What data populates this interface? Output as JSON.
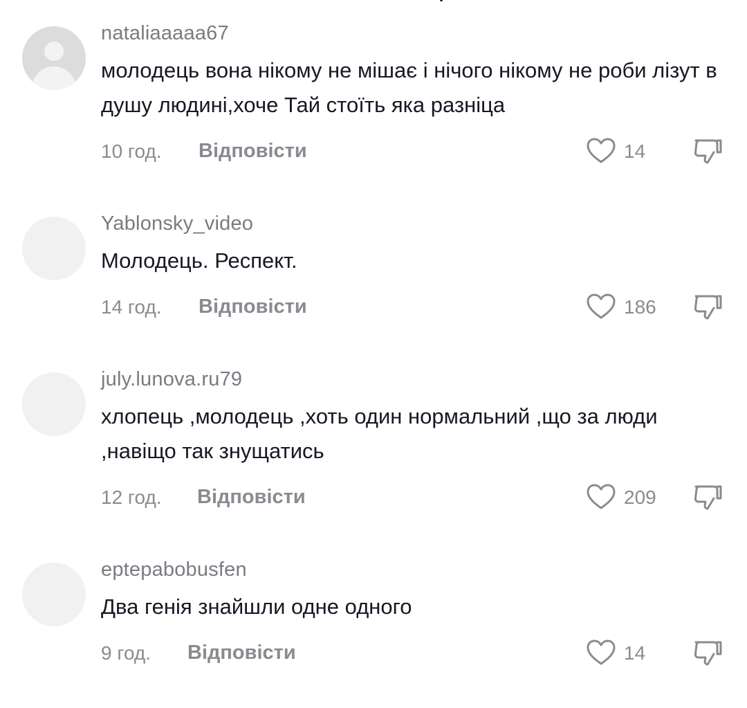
{
  "comments": [
    {
      "username": "nataliaaaaa67",
      "text": "молодець вона нікому не мішає і нічого нікому не роби лізут в душу людині,хоче Тай стоїть яка разніца",
      "time": "10 год.",
      "reply_label": "Відповісти",
      "likes": "14",
      "avatar": "default-avatar"
    },
    {
      "username": "Yablonsky_video",
      "text": "Молодець. Респект.",
      "time": "14 год.",
      "reply_label": "Відповісти",
      "likes": "186",
      "avatar": "blank-avatar"
    },
    {
      "username": "july.lunova.ru79",
      "text": "хлопець ,молодець ,хоть один нормальний ,що за люди ,навіщо так знущатись",
      "time": "12 год.",
      "reply_label": "Відповісти",
      "likes": "209",
      "avatar": "blank-avatar"
    },
    {
      "username": "eptepabobusfen",
      "text": "Два генія знайшли одне одного",
      "time": "9 год.",
      "reply_label": "Відповісти",
      "likes": "14",
      "avatar": "blank-avatar"
    }
  ],
  "icons": {
    "like": "heart-outline-icon",
    "dislike": "thumb-down-icon"
  },
  "colors": {
    "text": "#161823",
    "secondary": "#8a8b91",
    "avatar_placeholder": "#f1f1f2"
  }
}
